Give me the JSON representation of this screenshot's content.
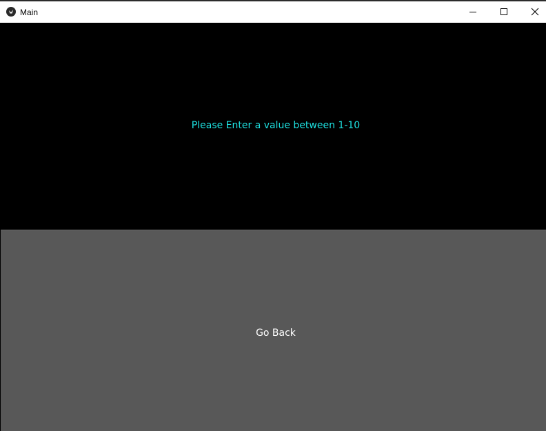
{
  "window": {
    "title": "Main",
    "app_icon": "kivy-logo-icon",
    "controls": {
      "minimize_icon": "minimize-icon",
      "maximize_icon": "maximize-icon",
      "close_icon": "close-icon"
    }
  },
  "main": {
    "prompt_text": "Please Enter a value between 1-10",
    "prompt_color": "#1ee3e3",
    "background_color": "#000000"
  },
  "back_button": {
    "label": "Go Back",
    "background_color": "#585858",
    "text_color": "#ffffff"
  }
}
